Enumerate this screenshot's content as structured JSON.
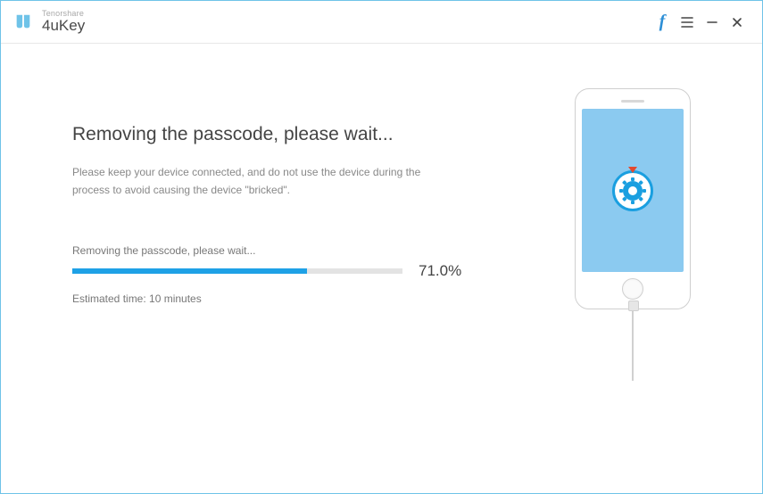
{
  "header": {
    "company": "Tenorshare",
    "product": "4uKey"
  },
  "main": {
    "heading": "Removing the passcode, please wait...",
    "description": "Please keep your device connected, and do not use the device during the process to avoid causing the device \"bricked\"."
  },
  "progress": {
    "label": "Removing the passcode, please wait...",
    "percent_value": 71.0,
    "percent_text": "71.0%",
    "estimated": "Estimated time: 10 minutes"
  },
  "colors": {
    "accent": "#1ea1e6",
    "border": "#6fc3e8"
  }
}
